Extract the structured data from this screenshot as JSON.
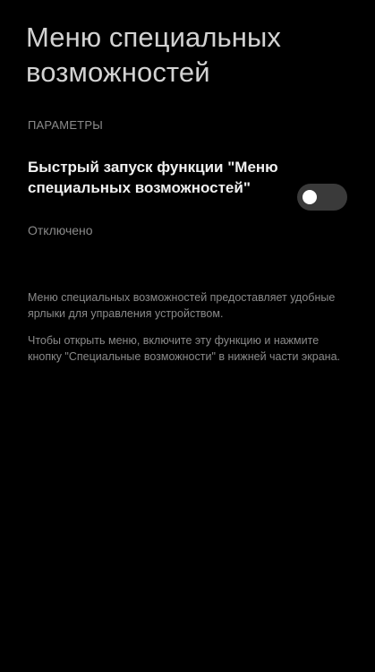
{
  "page": {
    "title": "Меню специальных возможностей"
  },
  "section": {
    "header": "ПАРАМЕТРЫ"
  },
  "setting": {
    "title": "Быстрый запуск функции \"Меню специальных возможностей\"",
    "summary": "Отключено",
    "toggle_on": false
  },
  "description": {
    "paragraph_1": "Меню специальных возможностей предоставляет удобные ярлыки для управления устройством.",
    "paragraph_2": "Чтобы открыть меню, включите эту функцию и нажмите кнопку \"Специальные возможности\" в нижней части экрана."
  },
  "colors": {
    "background": "#000000",
    "toggle_track_off": "#3a3a3a",
    "toggle_thumb": "#ffffff",
    "secondary_text": "#8a8a8a"
  }
}
